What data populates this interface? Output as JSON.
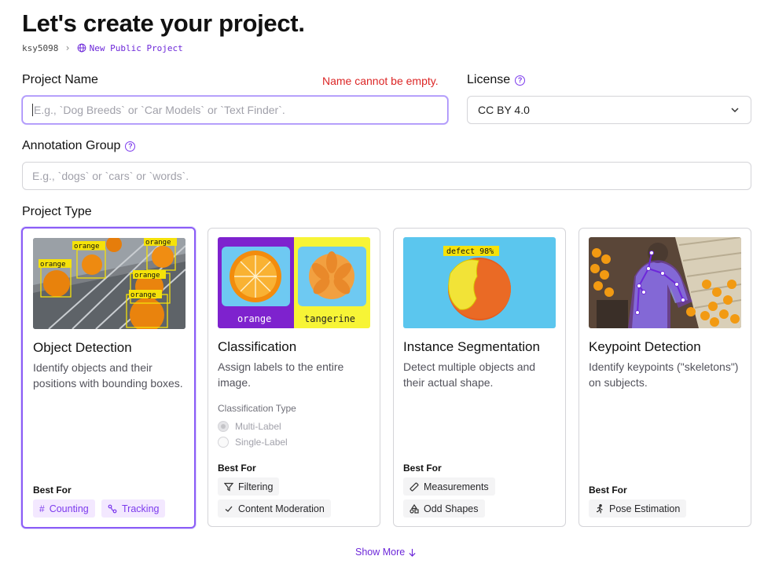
{
  "header": {
    "title": "Let's create your project.",
    "breadcrumb_user": "ksy5098",
    "breadcrumb_project": "New Public Project"
  },
  "form": {
    "project_name_label": "Project Name",
    "project_name_error": "Name cannot be empty.",
    "project_name_placeholder": "E.g., `Dog Breeds` or `Car Models` or `Text Finder`.",
    "project_name_value": "",
    "license_label": "License",
    "license_value": "CC BY 4.0",
    "annotation_group_label": "Annotation Group",
    "annotation_group_placeholder": "E.g., `dogs` or `cars` or `words`.",
    "annotation_group_value": "",
    "project_type_label": "Project Type"
  },
  "cards": [
    {
      "name": "Object Detection",
      "description": "Identify objects and their positions with bounding boxes.",
      "best_for_label": "Best For",
      "tags": [
        "Counting",
        "Tracking"
      ],
      "image_labels": [
        "orange",
        "orange",
        "orange",
        "orange",
        "orange"
      ],
      "selected": true
    },
    {
      "name": "Classification",
      "description": "Assign labels to the entire image.",
      "classification_type_label": "Classification Type",
      "options": [
        "Multi-Label",
        "Single-Label"
      ],
      "best_for_label": "Best For",
      "tags": [
        "Filtering",
        "Content Moderation"
      ],
      "image_labels": [
        "orange",
        "tangerine"
      ]
    },
    {
      "name": "Instance Segmentation",
      "description": "Detect multiple objects and their actual shape.",
      "best_for_label": "Best For",
      "tags": [
        "Measurements",
        "Odd Shapes"
      ],
      "image_labels": [
        "defect 98%"
      ]
    },
    {
      "name": "Keypoint Detection",
      "description": "Identify keypoints (\"skeletons\") on subjects.",
      "best_for_label": "Best For",
      "tags": [
        "Pose Estimation"
      ]
    }
  ],
  "footer": {
    "show_more": "Show More"
  },
  "icons": {
    "breadcrumb_separator": "chevron-right-icon",
    "project_visibility": "globe-icon",
    "help": "help-circle-icon",
    "select": "chevron-down-icon",
    "tags": [
      "hash-icon",
      "tracking-icon",
      "filter-icon",
      "check-icon",
      "ruler-icon",
      "shapes-icon",
      "person-running-icon"
    ],
    "show_more": "arrow-down-icon"
  },
  "colors": {
    "accent": "#7c3aed",
    "error": "#dc2626",
    "selected_border": "#8b5cf6"
  }
}
